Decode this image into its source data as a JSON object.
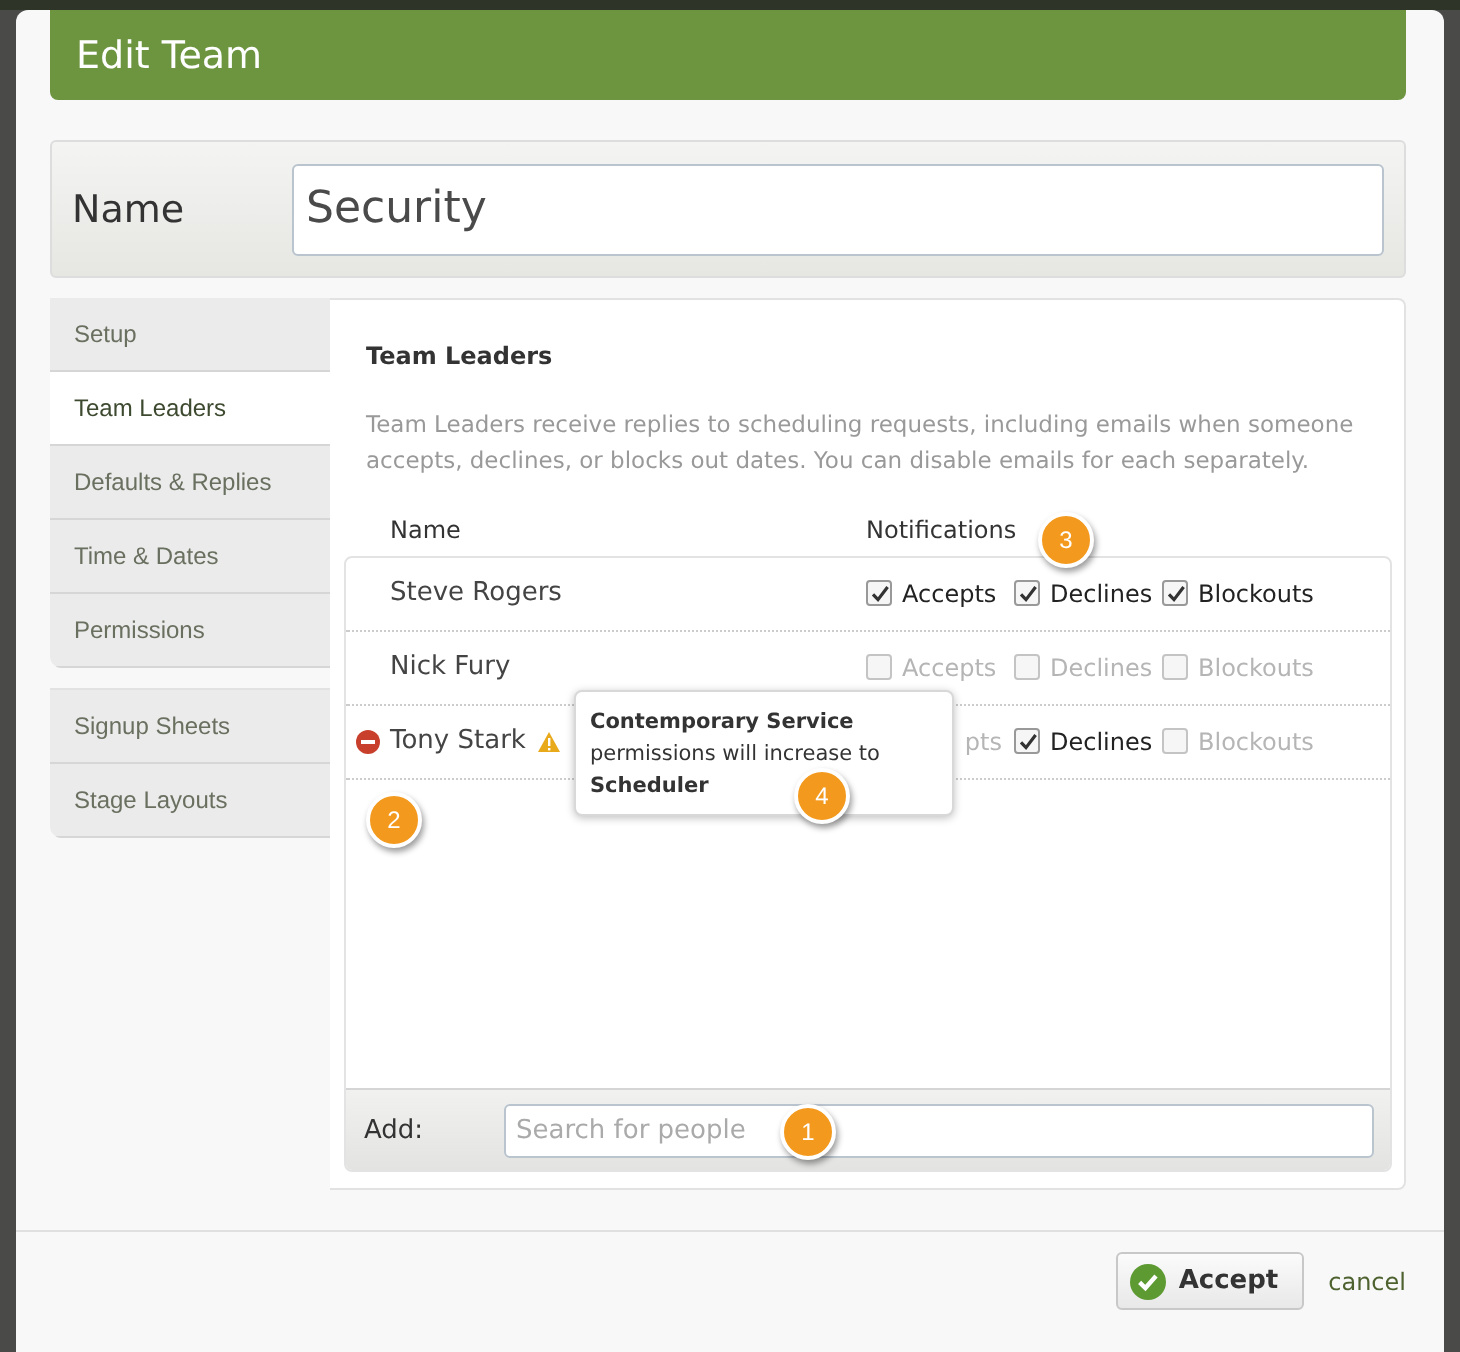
{
  "dialog": {
    "title": "Edit Team"
  },
  "name_field": {
    "label": "Name",
    "value": "Security"
  },
  "sidebar": {
    "groups": [
      [
        {
          "label": "Setup",
          "selected": false
        },
        {
          "label": "Team Leaders",
          "selected": true
        },
        {
          "label": "Defaults & Replies",
          "selected": false
        },
        {
          "label": "Time & Dates",
          "selected": false
        },
        {
          "label": "Permissions",
          "selected": false
        }
      ],
      [
        {
          "label": "Signup Sheets",
          "selected": false
        },
        {
          "label": "Stage Layouts",
          "selected": false
        }
      ]
    ]
  },
  "section": {
    "title": "Team Leaders",
    "description": "Team Leaders receive replies to scheduling requests, including emails when someone accepts, declines, or blocks out dates. You can disable emails for each separately."
  },
  "table": {
    "columns": [
      "Name",
      "Notifications"
    ],
    "rows": [
      {
        "name": "Steve Rogers",
        "removable": false,
        "warning": false,
        "notifications": [
          {
            "label": "Accepts",
            "checked": true,
            "covered": false
          },
          {
            "label": "Declines",
            "checked": true,
            "covered": false
          },
          {
            "label": "Blockouts",
            "checked": true,
            "covered": false
          }
        ]
      },
      {
        "name": "Nick Fury",
        "removable": false,
        "warning": false,
        "notifications": [
          {
            "label": "Accepts",
            "checked": false,
            "covered": false
          },
          {
            "label": "Declines",
            "checked": false,
            "covered": false
          },
          {
            "label": "Blockouts",
            "checked": false,
            "covered": false
          }
        ]
      },
      {
        "name": "Tony Stark",
        "removable": true,
        "warning": true,
        "notifications": [
          {
            "label": "pts",
            "covered": true
          },
          {
            "label": "Declines",
            "checked": true,
            "covered": false
          },
          {
            "label": "Blockouts",
            "checked": false,
            "covered": false
          }
        ]
      }
    ],
    "add": {
      "label": "Add:",
      "placeholder": "Search for people"
    }
  },
  "tooltip": {
    "text": "**Contemporary Service**\npermissions will increase to\n**Scheduler**"
  },
  "buttons": {
    "accept": "Accept",
    "cancel": "cancel"
  },
  "callouts": [
    "1",
    "2",
    "3",
    "4"
  ]
}
